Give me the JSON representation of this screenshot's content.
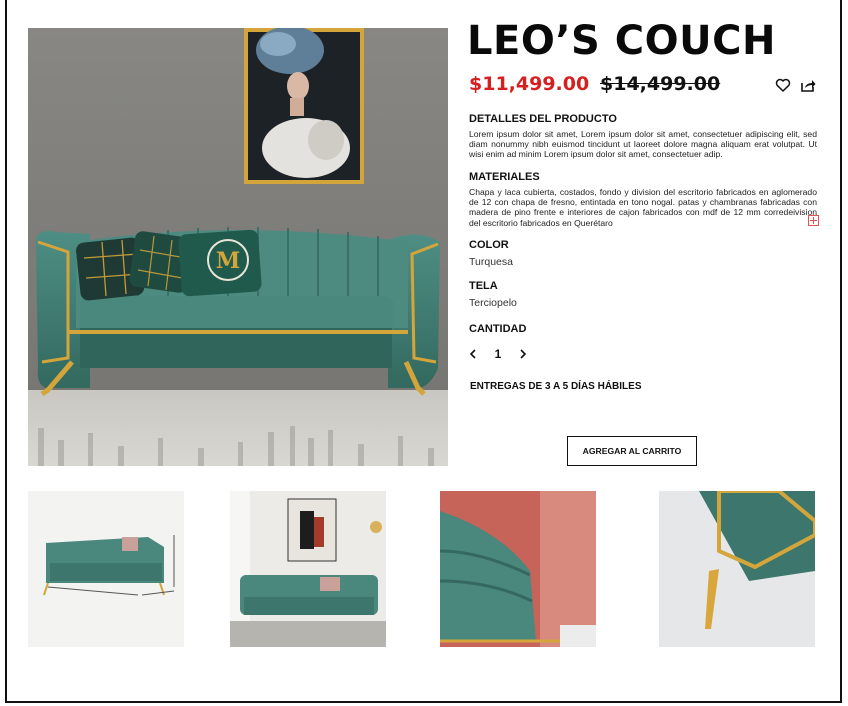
{
  "product": {
    "title": "LEO’S COUCH",
    "price": "$11,499.00",
    "original_price": "$14,499.00"
  },
  "details": {
    "heading": "DETALLES DEL PRODUCTO",
    "text": "Lorem ipsum dolor sit amet, Lorem ipsum dolor sit amet, consectetuer adipiscing elit, sed diam nonummy nibh euismod tincidunt ut laoreet dolore magna aliquam erat volutpat. Ut wisi enim ad minim Lorem ipsum dolor sit amet, consectetuer adip."
  },
  "materials": {
    "heading": "MATERIALES",
    "text": "Chapa y laca cubierta, costados, fondo y division del escritorio fabricados en aglomerado de 12 con chapa de fresno, entintada en tono nogal. patas y chambranas fabricadas con madera de pino frente e interiores de cajon fabricados con mdf de 12 mm corredeivision del escritorio fabricados en Querétaro"
  },
  "color": {
    "heading": "COLOR",
    "value": "Turquesa"
  },
  "fabric": {
    "heading": "TELA",
    "value": "Terciopelo"
  },
  "quantity": {
    "heading": "CANTIDAD",
    "value": "1"
  },
  "delivery": "ENTREGAS DE 3 A 5 DÍAS HÁBILES",
  "cart_button": "AGREGAR AL CARRITO",
  "colors": {
    "price_red": "#d61f1f",
    "sofa_teal": "#3f7d74",
    "gold": "#d4a53a"
  },
  "icons": [
    "heart-icon",
    "share-icon",
    "chevron-left-icon",
    "chevron-right-icon",
    "expand-icon"
  ]
}
